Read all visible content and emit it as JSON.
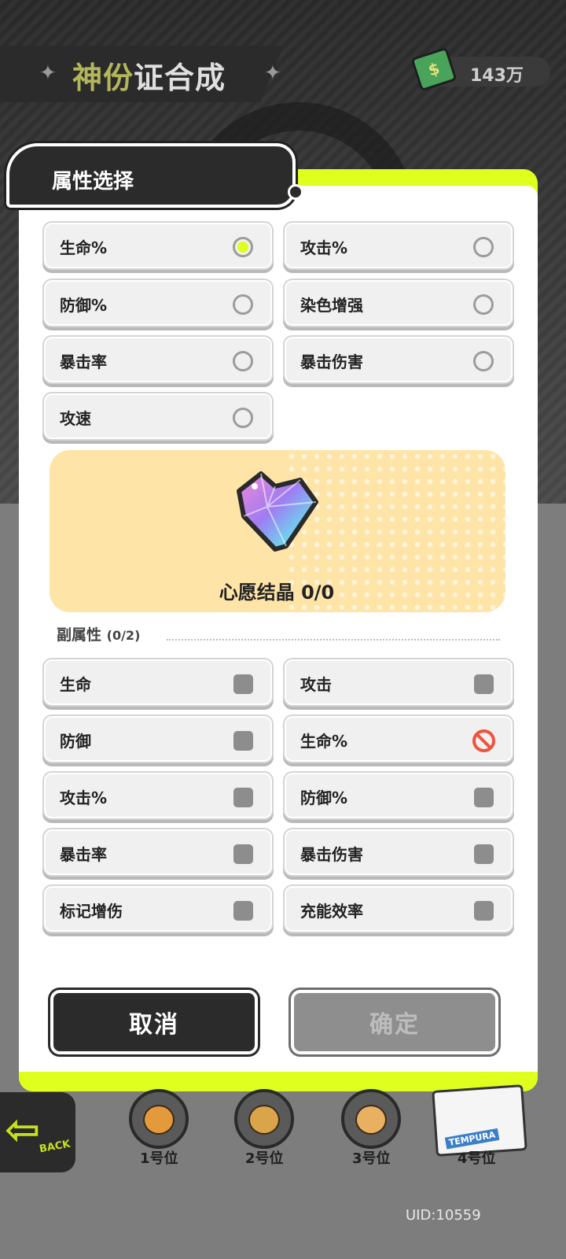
{
  "header": {
    "title_accent": "神份",
    "title_rest": "证合成",
    "currency_value": "143万",
    "currency_icon": "cash-icon"
  },
  "dialog": {
    "title": "属性选择",
    "main_options": [
      {
        "label": "生命%",
        "selected": true
      },
      {
        "label": "攻击%",
        "selected": false
      },
      {
        "label": "防御%",
        "selected": false
      },
      {
        "label": "染色增强",
        "selected": false
      },
      {
        "label": "暴击率",
        "selected": false
      },
      {
        "label": "暴击伤害",
        "selected": false
      },
      {
        "label": "攻速",
        "selected": false
      }
    ],
    "crystal": {
      "label": "心愿结晶 0/0",
      "icon": "crystal-heart-icon"
    },
    "sub_heading": "副属性",
    "sub_count": "(0/2)",
    "sub_options": [
      {
        "label": "生命",
        "state": "unchecked"
      },
      {
        "label": "攻击",
        "state": "unchecked"
      },
      {
        "label": "防御",
        "state": "unchecked"
      },
      {
        "label": "生命%",
        "state": "disabled"
      },
      {
        "label": "攻击%",
        "state": "unchecked"
      },
      {
        "label": "防御%",
        "state": "unchecked"
      },
      {
        "label": "暴击率",
        "state": "unchecked"
      },
      {
        "label": "暴击伤害",
        "state": "unchecked"
      },
      {
        "label": "标记增伤",
        "state": "unchecked"
      },
      {
        "label": "充能效率",
        "state": "unchecked"
      }
    ],
    "cancel_label": "取消",
    "confirm_label": "确定"
  },
  "bottom_bar": {
    "back_label": "BACK",
    "slots": [
      "1号位",
      "2号位",
      "3号位",
      "4号位"
    ],
    "slot4_tag": "TEMPURA"
  },
  "uid": "UID:10559",
  "colors": {
    "accent": "#dfff1f",
    "dark": "#2b2b2b",
    "panel": "#ffe4a8",
    "disabled_red": "#f0533d"
  }
}
